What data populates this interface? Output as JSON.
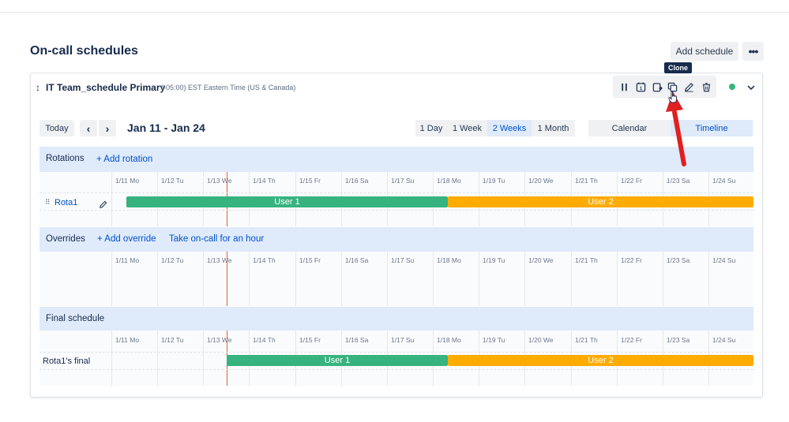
{
  "page": {
    "title": "On-call schedules",
    "add_schedule_label": "Add schedule",
    "more_label": "•••"
  },
  "schedule": {
    "name": "IT Team_schedule Primary",
    "timezone": "(-05:00) EST Eastern Time (US & Canada)",
    "status_color": "#36b37e",
    "tooltip": "Clone",
    "toolbar_icons": [
      "pause-icon",
      "calendar-day-icon",
      "calendar-export-icon",
      "clone-icon",
      "edit-icon",
      "delete-icon"
    ]
  },
  "nav": {
    "today_label": "Today",
    "prev_label": "‹",
    "next_label": "›",
    "date_range": "Jan 11 - Jan 24",
    "ranges": [
      {
        "label": "1 Day",
        "active": false
      },
      {
        "label": "1 Week",
        "active": false
      },
      {
        "label": "2 Weeks",
        "active": true
      },
      {
        "label": "1 Month",
        "active": false
      }
    ],
    "views": [
      {
        "label": "Calendar",
        "active": false
      },
      {
        "label": "Timeline",
        "active": true
      }
    ]
  },
  "days": [
    "1/11 Mo",
    "1/12 Tu",
    "1/13 We",
    "1/14 Th",
    "1/15 Fr",
    "1/16 Sa",
    "1/17 Su",
    "1/18 Mo",
    "1/19 Tu",
    "1/20 We",
    "1/21 Th",
    "1/22 Fr",
    "1/23 Sa",
    "1/24 Su"
  ],
  "rotations": {
    "title": "Rotations",
    "add_label": "+ Add rotation",
    "rota_name": "Rota1",
    "bars": [
      {
        "label": "User 1",
        "color": "#36b37e"
      },
      {
        "label": "User 2",
        "color": "#ffab00"
      }
    ]
  },
  "overrides": {
    "title": "Overrides",
    "add_label": "+ Add override",
    "take_oncall_label": "Take on-call for an hour"
  },
  "final": {
    "title": "Final schedule",
    "row_label": "Rota1's final",
    "bars": [
      {
        "label": "User 1",
        "color": "#36b37e"
      },
      {
        "label": "User 2",
        "color": "#ffab00"
      }
    ]
  },
  "colors": {
    "accent": "#0052cc",
    "section_bg": "#dfeafb",
    "now_line": "#de350b",
    "annotation_arrow": "#e02020"
  }
}
